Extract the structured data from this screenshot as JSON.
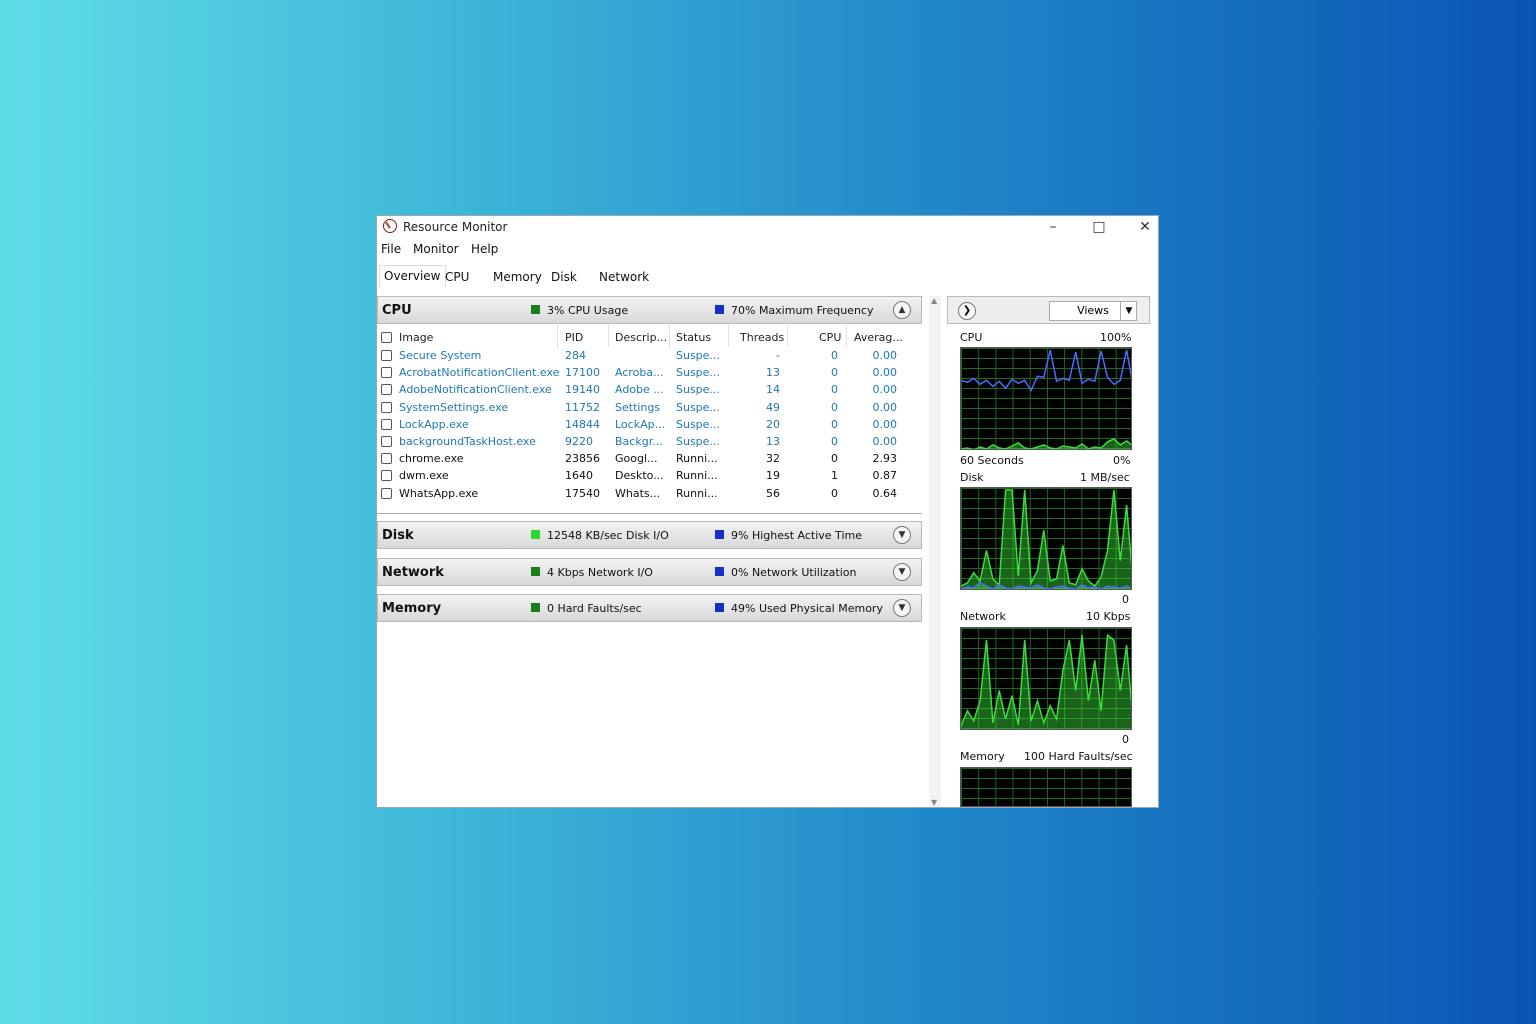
{
  "window": {
    "title": "Resource Monitor"
  },
  "menu": [
    "File",
    "Monitor",
    "Help"
  ],
  "tabs": [
    "Overview",
    "CPU",
    "Memory",
    "Disk",
    "Network"
  ],
  "cpu_section": {
    "title": "CPU",
    "legend1": "3% CPU Usage",
    "legend2": "70% Maximum Frequency",
    "columns": [
      "Image",
      "PID",
      "Descrip...",
      "Status",
      "Threads",
      "CPU",
      "Averag..."
    ],
    "rows": [
      {
        "image": "Secure System",
        "pid": "284",
        "desc": "",
        "status": "Suspe...",
        "threads": "-",
        "cpu": "0",
        "avg": "0.00",
        "suspended": true
      },
      {
        "image": "AcrobatNotificationClient.exe",
        "pid": "17100",
        "desc": "Acroba...",
        "status": "Suspe...",
        "threads": "13",
        "cpu": "0",
        "avg": "0.00",
        "suspended": true
      },
      {
        "image": "AdobeNotificationClient.exe",
        "pid": "19140",
        "desc": "Adobe ...",
        "status": "Suspe...",
        "threads": "14",
        "cpu": "0",
        "avg": "0.00",
        "suspended": true
      },
      {
        "image": "SystemSettings.exe",
        "pid": "11752",
        "desc": "Settings",
        "status": "Suspe...",
        "threads": "49",
        "cpu": "0",
        "avg": "0.00",
        "suspended": true
      },
      {
        "image": "LockApp.exe",
        "pid": "14844",
        "desc": "LockAp...",
        "status": "Suspe...",
        "threads": "20",
        "cpu": "0",
        "avg": "0.00",
        "suspended": true
      },
      {
        "image": "backgroundTaskHost.exe",
        "pid": "9220",
        "desc": "Backgr...",
        "status": "Suspe...",
        "threads": "13",
        "cpu": "0",
        "avg": "0.00",
        "suspended": true
      },
      {
        "image": "chrome.exe",
        "pid": "23856",
        "desc": "Googl...",
        "status": "Runni...",
        "threads": "32",
        "cpu": "0",
        "avg": "2.93",
        "suspended": false
      },
      {
        "image": "dwm.exe",
        "pid": "1640",
        "desc": "Deskto...",
        "status": "Runni...",
        "threads": "19",
        "cpu": "1",
        "avg": "0.87",
        "suspended": false
      },
      {
        "image": "WhatsApp.exe",
        "pid": "17540",
        "desc": "Whats...",
        "status": "Runni...",
        "threads": "56",
        "cpu": "0",
        "avg": "0.64",
        "suspended": false
      }
    ]
  },
  "disk_section": {
    "title": "Disk",
    "legend1": "12548 KB/sec Disk I/O",
    "legend2": "9% Highest Active Time"
  },
  "network_section": {
    "title": "Network",
    "legend1": "4 Kbps Network I/O",
    "legend2": "0% Network Utilization"
  },
  "memory_section": {
    "title": "Memory",
    "legend1": "0 Hard Faults/sec",
    "legend2": "49% Used Physical Memory"
  },
  "colors": {
    "suspended_text": "#1e78b4",
    "legend_green": "#1a7f1a",
    "legend_bright_green": "#2ed62e",
    "legend_blue": "#1530c8",
    "graph_green": "#3cdc3c",
    "graph_blue": "#4a6cff"
  },
  "right_panel": {
    "views_label": "Views",
    "cpu_graph": {
      "label": "CPU",
      "max": "100%",
      "time": "60 Seconds",
      "min": "0%"
    },
    "disk_graph": {
      "label": "Disk",
      "max": "1 MB/sec",
      "min": "0"
    },
    "network_graph": {
      "label": "Network",
      "max": "10 Kbps",
      "min": "0"
    },
    "memory_graph": {
      "label": "Memory",
      "max": "100 Hard Faults/sec"
    }
  },
  "chart_data": [
    {
      "type": "line",
      "title": "CPU",
      "ylim": [
        0,
        100
      ],
      "series": [
        {
          "values": [
            70,
            68,
            72,
            66,
            70,
            64,
            69,
            62,
            71,
            67,
            70,
            60,
            74,
            73,
            100,
            69,
            72,
            70,
            98,
            67,
            71,
            69,
            99,
            73,
            66,
            70,
            100,
            65
          ]
        },
        {
          "values": [
            2,
            3,
            1,
            4,
            2,
            6,
            3,
            2,
            5,
            8,
            3,
            2,
            4,
            6,
            3,
            2,
            5,
            4,
            3,
            7,
            2,
            4,
            3,
            9,
            12,
            6,
            10,
            5
          ]
        }
      ]
    },
    {
      "type": "line",
      "title": "Disk",
      "ylim": [
        0,
        100
      ],
      "series": [
        {
          "values": [
            5,
            8,
            18,
            10,
            40,
            12,
            6,
            100,
            100,
            15,
            100,
            8,
            20,
            60,
            10,
            12,
            45,
            8,
            6,
            22,
            10,
            5,
            14,
            40,
            100,
            30,
            85,
            10
          ]
        },
        {
          "values": [
            2,
            4,
            3,
            8,
            5,
            2,
            6,
            3,
            2,
            5,
            4,
            3,
            6,
            3,
            2,
            4,
            5,
            3,
            2,
            6,
            3,
            4,
            2,
            5,
            4,
            3,
            5,
            2
          ]
        }
      ]
    },
    {
      "type": "line",
      "title": "Network",
      "ylim": [
        0,
        100
      ],
      "series": [
        {
          "values": [
            5,
            20,
            10,
            30,
            90,
            8,
            40,
            12,
            35,
            6,
            90,
            10,
            30,
            8,
            25,
            12,
            60,
            90,
            40,
            95,
            30,
            70,
            20,
            95,
            90,
            40,
            85,
            10
          ]
        }
      ]
    }
  ]
}
